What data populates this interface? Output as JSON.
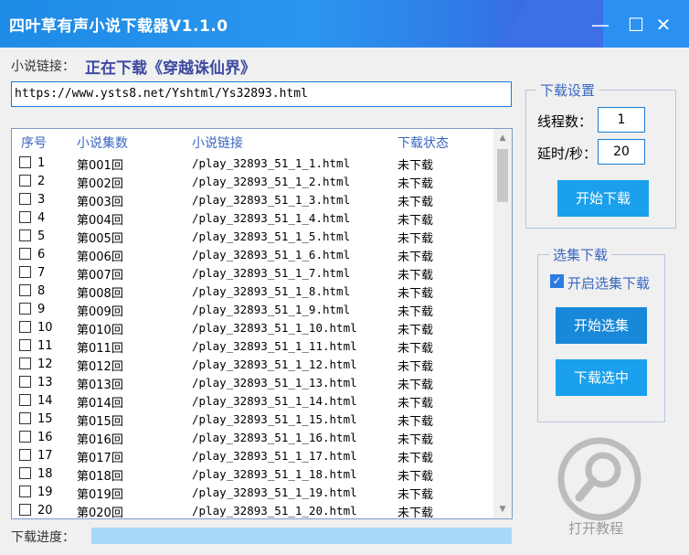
{
  "window": {
    "title": "四叶草有声小说下载器V1.1.0",
    "minimize": "—",
    "maximize": "☐",
    "close": "✕"
  },
  "link_label": "小说链接：",
  "status_text": "正在下载《穿越诛仙界》",
  "url_value": "https://www.ysts8.net/Yshtml/Ys32893.html",
  "table": {
    "headers": [
      "序号",
      "小说集数",
      "小说链接",
      "下载状态"
    ],
    "rows": [
      {
        "no": "1",
        "episode": "第001回",
        "link": "/play_32893_51_1_1.html",
        "status": "未下载"
      },
      {
        "no": "2",
        "episode": "第002回",
        "link": "/play_32893_51_1_2.html",
        "status": "未下载"
      },
      {
        "no": "3",
        "episode": "第003回",
        "link": "/play_32893_51_1_3.html",
        "status": "未下载"
      },
      {
        "no": "4",
        "episode": "第004回",
        "link": "/play_32893_51_1_4.html",
        "status": "未下载"
      },
      {
        "no": "5",
        "episode": "第005回",
        "link": "/play_32893_51_1_5.html",
        "status": "未下载"
      },
      {
        "no": "6",
        "episode": "第006回",
        "link": "/play_32893_51_1_6.html",
        "status": "未下载"
      },
      {
        "no": "7",
        "episode": "第007回",
        "link": "/play_32893_51_1_7.html",
        "status": "未下载"
      },
      {
        "no": "8",
        "episode": "第008回",
        "link": "/play_32893_51_1_8.html",
        "status": "未下载"
      },
      {
        "no": "9",
        "episode": "第009回",
        "link": "/play_32893_51_1_9.html",
        "status": "未下载"
      },
      {
        "no": "10",
        "episode": "第010回",
        "link": "/play_32893_51_1_10.html",
        "status": "未下载"
      },
      {
        "no": "11",
        "episode": "第011回",
        "link": "/play_32893_51_1_11.html",
        "status": "未下载"
      },
      {
        "no": "12",
        "episode": "第012回",
        "link": "/play_32893_51_1_12.html",
        "status": "未下载"
      },
      {
        "no": "13",
        "episode": "第013回",
        "link": "/play_32893_51_1_13.html",
        "status": "未下载"
      },
      {
        "no": "14",
        "episode": "第014回",
        "link": "/play_32893_51_1_14.html",
        "status": "未下载"
      },
      {
        "no": "15",
        "episode": "第015回",
        "link": "/play_32893_51_1_15.html",
        "status": "未下载"
      },
      {
        "no": "16",
        "episode": "第016回",
        "link": "/play_32893_51_1_16.html",
        "status": "未下载"
      },
      {
        "no": "17",
        "episode": "第017回",
        "link": "/play_32893_51_1_17.html",
        "status": "未下载"
      },
      {
        "no": "18",
        "episode": "第018回",
        "link": "/play_32893_51_1_18.html",
        "status": "未下载"
      },
      {
        "no": "19",
        "episode": "第019回",
        "link": "/play_32893_51_1_19.html",
        "status": "未下载"
      },
      {
        "no": "20",
        "episode": "第020回",
        "link": "/play_32893_51_1_20.html",
        "status": "未下载"
      }
    ]
  },
  "download_settings": {
    "title": "下载设置",
    "threads_label": "线程数：",
    "threads_value": "1",
    "delay_label": "延时/秒：",
    "delay_value": "20",
    "start_button": "开始下载"
  },
  "episode_select": {
    "title": "选集下载",
    "enable_label": "开启选集下载",
    "enable_checked": true,
    "start_select_button": "开始选集",
    "download_selected_button": "下载选中"
  },
  "tutorial_label": "打开教程",
  "progress_label": "下载进度：",
  "icons": {
    "minimize": "minimize-icon",
    "maximize": "maximize-icon",
    "close": "close-icon",
    "tutorial": "magnifier-icon",
    "scroll_up": "chevron-up-icon",
    "scroll_down": "chevron-down-icon"
  },
  "colors": {
    "titlebar": "#1e8be6",
    "accent_button": "#1aa0ec",
    "status_text": "#3f4aa0",
    "header_text": "#3a66c2",
    "progress": "#a8d8f8"
  }
}
